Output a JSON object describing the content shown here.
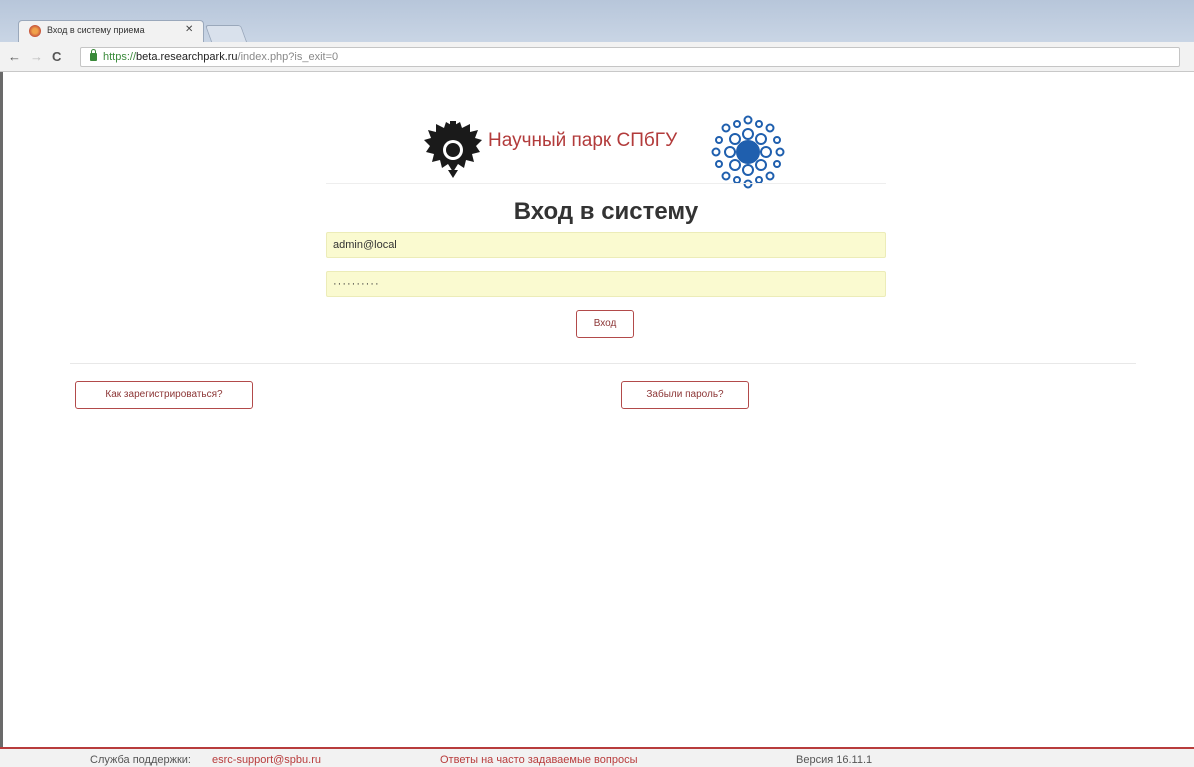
{
  "browser": {
    "tab_title": "Вход в систему приема",
    "tab_close": "✕",
    "back_icon": "←",
    "forward_icon": "→",
    "reload_icon": "C",
    "url_scheme": "https://",
    "url_host": "beta.researchpark.ru",
    "url_path": "/index.php?is_exit=0"
  },
  "header": {
    "logo_text": "Научный парк СПбГУ"
  },
  "login": {
    "title": "Вход в систему",
    "login_value": "admin@local",
    "password_mask": "··········",
    "submit_label": "Вход"
  },
  "links": {
    "register_label": "Как зарегистрироваться?",
    "forgot_label": "Забыли пароль?"
  },
  "footer": {
    "support_label": "Служба поддержки:",
    "support_email": "esrc-support@spbu.ru",
    "faq_label": "Ответы на часто задаваемые вопросы",
    "version_label": "Версия 16.11.1"
  },
  "colors": {
    "accent": "#b23b3b",
    "input_bg": "#fafad0",
    "logo_blue": "#1f5fae"
  }
}
